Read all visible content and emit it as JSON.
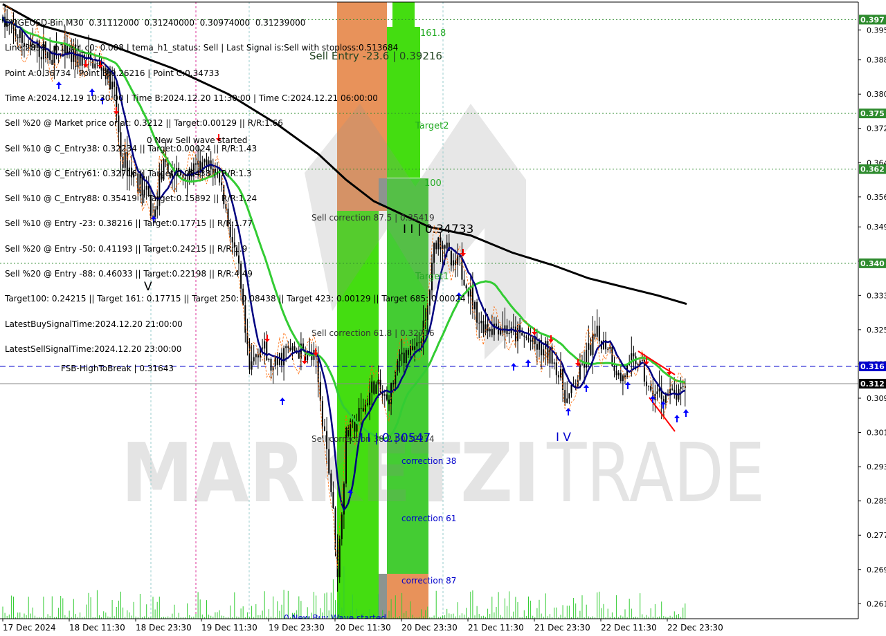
{
  "chart_data": {
    "type": "candlestick",
    "symbol": "DOGEUSD-Bin,M30",
    "ohlc_header": "DOGEUSD-Bin,M30  0.31112000  0.31240000  0.30974000  0.31239000",
    "info_lines": [
      "DOGEUSD-Bin,M30  0.31112000  0.31240000  0.30974000  0.31239000",
      "Line:2838 | h1_atr_c0: 0.008 | tema_h1_status: Sell | Last Signal is:Sell with stoploss:0.513684",
      "Point A:0.36734 | Point B:0.26216 | Point C:0.34733",
      "Time A:2024.12.19 10:30:00 | Time B:2024.12.20 11:30:00 | Time C:2024.12.21 06:00:00",
      "Sell %20 @ Market price or at: 0.3212 || Target:0.00129 || R/R:1.66",
      "Sell %10 @ C_Entry38: 0.32234 || Target:0.00024 || R/R:1.43",
      "Sell %10 @ C_Entry61: 0.32716 || Target:0.08438 || R/R:1.3",
      "Sell %10 @ C_Entry88: 0.35419 || Target:0.15892 || R/R:1.24",
      "Sell %10 @ Entry -23: 0.38216 || Target:0.17715 || R/R:1.77",
      "Sell %20 @ Entry -50: 0.41193 || Target:0.24215 || R/R:1.9",
      "Sell %20 @ Entry -88: 0.46033 || Target:0.22198 || R/R:4.49",
      "Target100: 0.24215 || Target 161: 0.17715 || Target 250: 0.08438 || Target 423: 0.00129 || Target 685: 0.00024",
      "LatestBuySignalTime:2024.12.20 21:00:00",
      "LatestSellSignalTime:2024.12.20 23:00:00"
    ],
    "y_ticks": [
      "0.395",
      "0.388",
      "0.380",
      "0.372",
      "0.364",
      "0.356",
      "0.349",
      "0.341",
      "0.333",
      "0.325",
      "0.317",
      "0.309",
      "0.301",
      "0.293",
      "0.285",
      "0.277",
      "0.269",
      "0.261"
    ],
    "ylim": [
      0.2575,
      0.4015
    ],
    "x_ticks": [
      "17 Dec 2024",
      "18 Dec 11:30",
      "18 Dec 23:30",
      "19 Dec 11:30",
      "19 Dec 23:30",
      "20 Dec 11:30",
      "20 Dec 23:30",
      "21 Dec 11:30",
      "21 Dec 23:30",
      "22 Dec 11:30",
      "22 Dec 23:30"
    ],
    "price_levels": [
      {
        "label": "0.397",
        "value": 0.3974,
        "color": "#2e8b2e",
        "style": "dotted"
      },
      {
        "label": "0.375",
        "value": 0.3755,
        "color": "#2e8b2e",
        "style": "dotted"
      },
      {
        "label": "0.362",
        "value": 0.3625,
        "color": "#2e8b2e",
        "style": "dotted"
      },
      {
        "label": "0.340",
        "value": 0.3405,
        "color": "#2e8b2e",
        "style": "dotted"
      },
      {
        "label": "0.316",
        "value": 0.31643,
        "color": "#0000cc",
        "style": "dashed"
      },
      {
        "label": "0.312",
        "value": 0.31239,
        "color": "#000000",
        "style": "solid"
      }
    ],
    "annotations": [
      "161.8",
      "Sell Entry -23.6 | 0.39216",
      "Target2",
      "100",
      "Sell correction 87.5 | 0.35419",
      "I I | 0.34733",
      "Target1",
      "Sell correction 61.8 | 0.32716",
      "FSB-HighToBreak | 0.31643",
      "Sell correction 38.2 | 0.32234",
      "I I | 0.30547",
      "correction 38",
      "correction 61",
      "correction 87",
      "0 New Sell wave started",
      "0 New Buy Wave started",
      "V",
      "I V"
    ],
    "watermark": "MARKETZITRADE",
    "colors": {
      "sma_green": "#33cc33",
      "ema_navy": "#000080",
      "ma_black": "#000000",
      "sell_arrow": "#ff0000",
      "buy_arrow": "#0000ff",
      "orange_zone": "#e8925a",
      "green_zone": "#33dd11"
    }
  }
}
